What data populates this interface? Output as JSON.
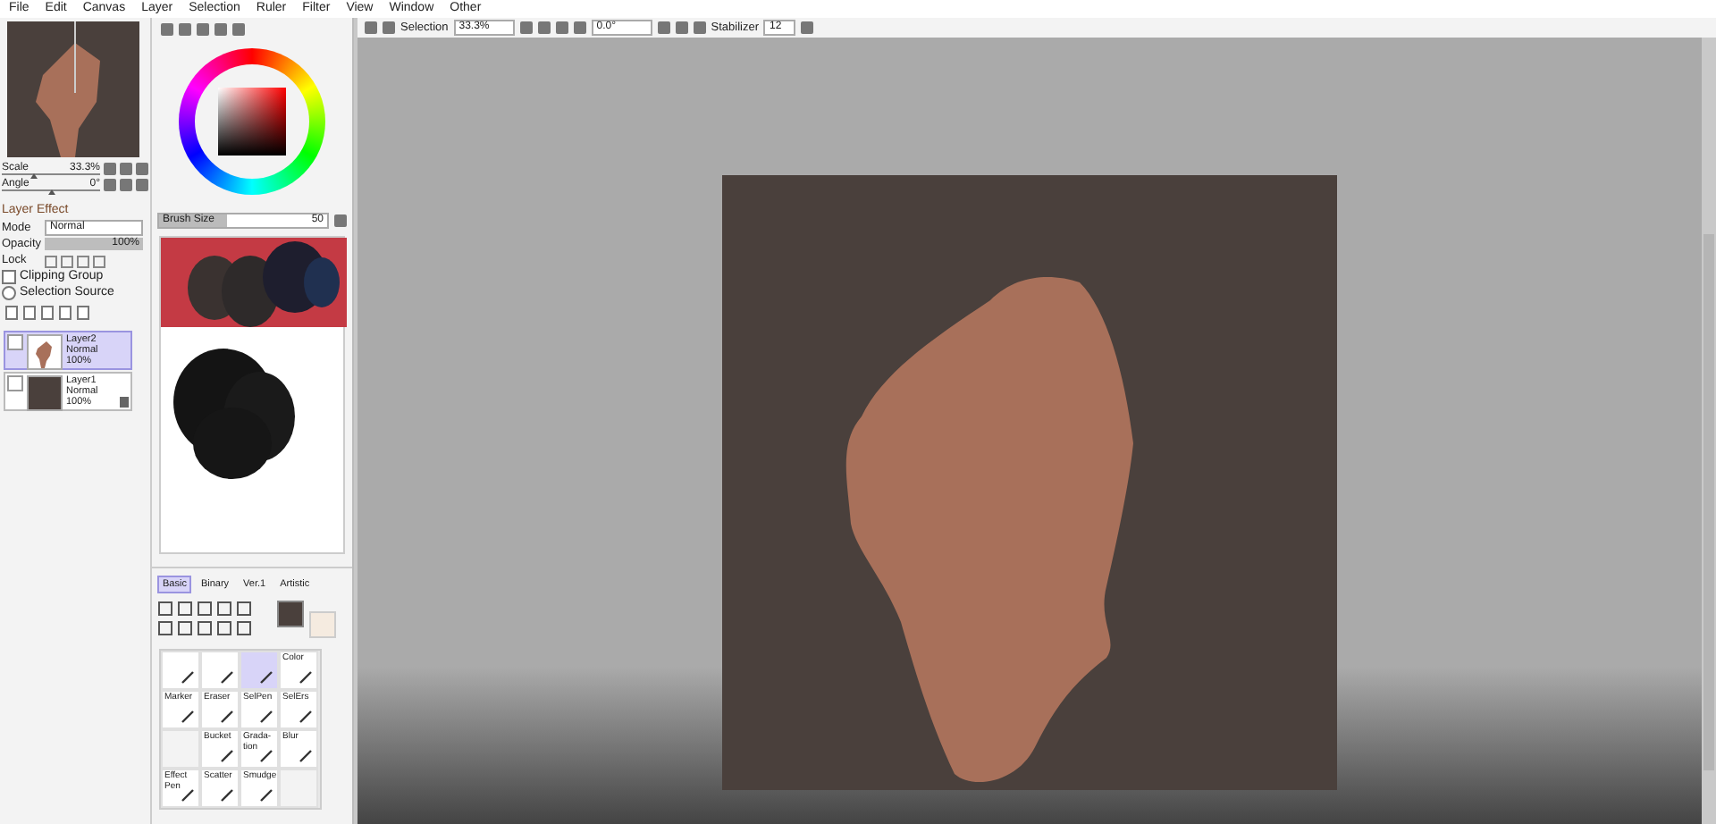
{
  "menu": [
    "File",
    "Edit",
    "Canvas",
    "Layer",
    "Selection",
    "Ruler",
    "Filter",
    "View",
    "Window",
    "Other"
  ],
  "navigator": {
    "scale_label": "Scale",
    "scale": "33.3%",
    "scale_level": {
      "level": 0.33
    },
    "angle_label": "Angle",
    "angle": "0°",
    "angle_level": {
      "level": 0.5
    }
  },
  "layer_effect": {
    "title": "Layer Effect"
  },
  "mode": {
    "label": "Mode",
    "value": "Normal"
  },
  "opacity": {
    "label": "Opacity",
    "value": "100%",
    "level": 1
  },
  "lock_label": "Lock",
  "clipping_group": {
    "label": "Clipping Group",
    "checked": false
  },
  "selection_source": {
    "label": "Selection Source",
    "selected": false
  },
  "layers": [
    {
      "name": "Layer2",
      "mode": "Normal",
      "opacity": "100%",
      "selected": true,
      "kind": "shape",
      "locked": false
    },
    {
      "name": "Layer1",
      "mode": "Normal",
      "opacity": "100%",
      "selected": false,
      "kind": "fill",
      "locked": true
    }
  ],
  "brush_size": {
    "label": "Brush Size",
    "value": "50",
    "level": 0.4
  },
  "tool_sets": [
    {
      "label": "Basic",
      "selected": true
    },
    {
      "label": "Binary",
      "selected": false
    },
    {
      "label": "Ver.1",
      "selected": false
    },
    {
      "label": "Artistic",
      "selected": false
    }
  ],
  "tools": [
    {
      "kind": "tool",
      "selected": false
    },
    {
      "kind": "tool",
      "selected": false
    },
    {
      "kind": "tool",
      "selected": true
    },
    {
      "kind": "tool",
      "label": "Color",
      "selected": false
    },
    {
      "kind": "tool",
      "label": "Marker",
      "selected": false
    },
    {
      "kind": "tool",
      "label": "Eraser",
      "selected": false
    },
    {
      "kind": "tool",
      "label": "SelPen",
      "selected": false
    },
    {
      "kind": "tool",
      "label": "SelErs",
      "selected": false
    },
    {
      "kind": "empty"
    },
    {
      "kind": "tool",
      "label": "Bucket",
      "selected": false
    },
    {
      "kind": "tool",
      "label": "Grada-tion",
      "selected": false
    },
    {
      "kind": "tool",
      "label": "Blur",
      "selected": false
    },
    {
      "kind": "tool",
      "label": "Effect Pen",
      "selected": false
    },
    {
      "kind": "tool",
      "label": "Scatter",
      "selected": false
    },
    {
      "kind": "tool",
      "label": "Smudge",
      "selected": false
    },
    {
      "kind": "empty"
    }
  ],
  "toolbar": {
    "selection_label": "Selection",
    "zoom": "33.3%",
    "angle": "0.0°",
    "stabilizer_label": "Stabilizer",
    "stabilizer": "12"
  }
}
